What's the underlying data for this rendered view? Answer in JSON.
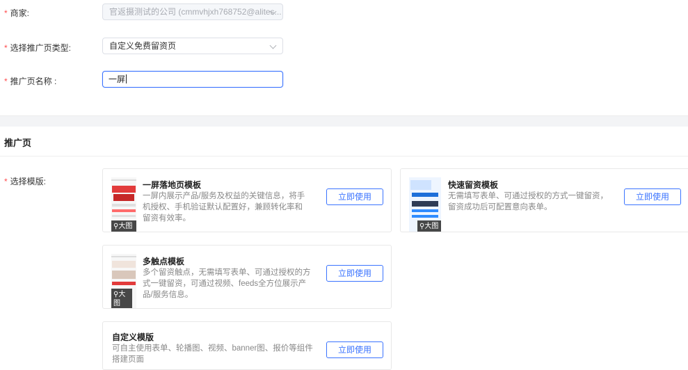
{
  "form": {
    "merchant": {
      "label": "商家:",
      "value": "官返摄测试的公司 (cmmvhjxh768752@alites..."
    },
    "promo_type": {
      "label": "选择推广页类型:",
      "value": "自定义免费留资页"
    },
    "promo_name": {
      "label": "推广页名称 :",
      "value": "一屏"
    }
  },
  "section": {
    "title": "推广页"
  },
  "template_label": "选择模版:",
  "templates": [
    {
      "title": "一屏落地页模板",
      "desc": "一屏内展示产品/服务及权益的关键信息，将手机授权、手机验证默认配置好，兼顾转化率和留资有效率。",
      "button": "立即使用",
      "zoom": "大图"
    },
    {
      "title": "快速留资模板",
      "desc": "无需填写表单、可通过授权的方式一键留资，留资成功后可配置意向表单。",
      "button": "立即使用",
      "zoom": "大图"
    },
    {
      "title": "多触点模板",
      "desc": "多个留资触点，无需填写表单、可通过授权的方式一键留资，可通过视频、feeds全方位展示产品/服务信息。",
      "button": "立即使用",
      "zoom": "大图"
    },
    {
      "title": "自定义模版",
      "desc": "可自主使用表单、轮播图、视频、banner图、报价等组件搭建页面",
      "button": "立即使用"
    }
  ],
  "colors": {
    "accent": "#3a73ff",
    "required": "#ff4d4f"
  }
}
